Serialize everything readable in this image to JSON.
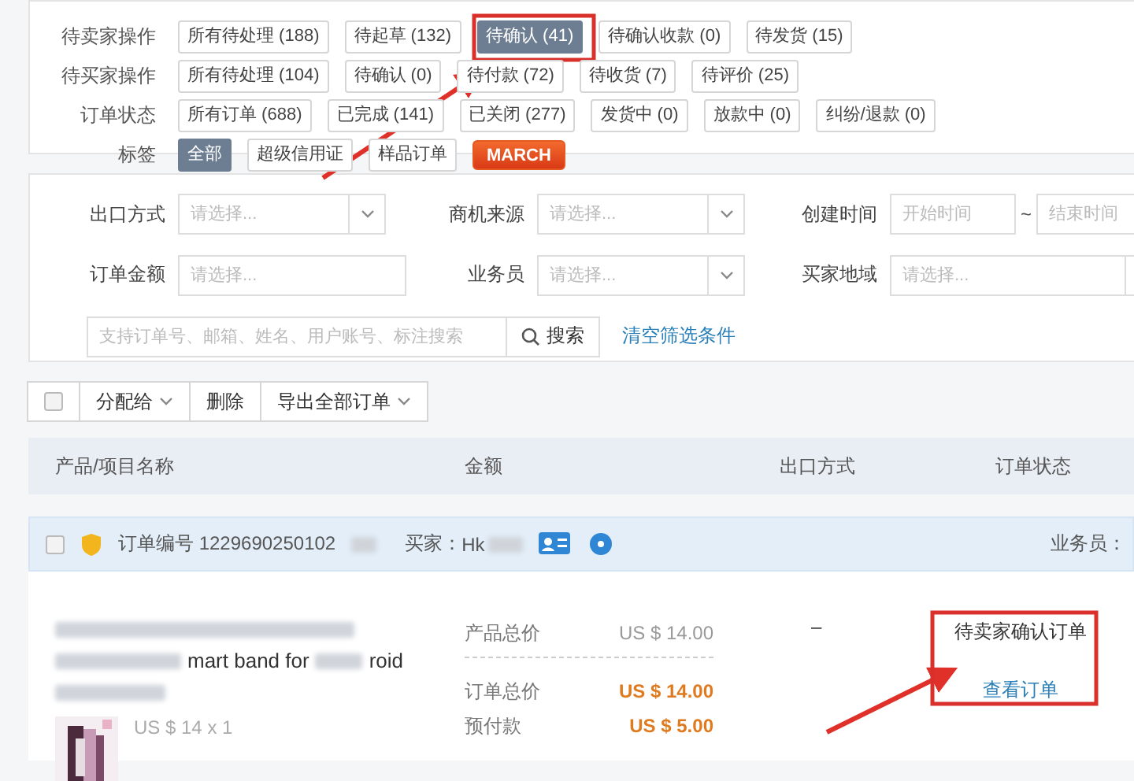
{
  "filters": {
    "groups": [
      {
        "label": "待卖家操作",
        "chips": [
          {
            "label": "所有待处理 (188)",
            "kind": "chip",
            "selected": false
          },
          {
            "label": "待起草 (132)",
            "kind": "chip",
            "selected": false
          },
          {
            "label": "待确认 (41)",
            "kind": "chip",
            "selected": true
          },
          {
            "label": "待确认收款 (0)",
            "kind": "chip",
            "selected": false
          },
          {
            "label": "待发货 (15)",
            "kind": "chip",
            "selected": false
          }
        ]
      },
      {
        "label": "待买家操作",
        "chips": [
          {
            "label": "所有待处理 (104)",
            "kind": "chip",
            "selected": false
          },
          {
            "label": "待确认 (0)",
            "kind": "chip",
            "selected": false
          },
          {
            "label": "待付款 (72)",
            "kind": "chip",
            "selected": false
          },
          {
            "label": "待收货 (7)",
            "kind": "chip",
            "selected": false
          },
          {
            "label": "待评价 (25)",
            "kind": "chip",
            "selected": false
          }
        ]
      },
      {
        "label": "订单状态",
        "chips": [
          {
            "label": "所有订单 (688)",
            "kind": "chip",
            "selected": false
          },
          {
            "label": "已完成 (141)",
            "kind": "chip",
            "selected": false
          },
          {
            "label": "已关闭 (277)",
            "kind": "chip",
            "selected": false
          },
          {
            "label": "发货中 (0)",
            "kind": "chip",
            "selected": false
          },
          {
            "label": "放款中 (0)",
            "kind": "chip",
            "selected": false
          },
          {
            "label": "纠纷/退款 (0)",
            "kind": "chip",
            "selected": false
          }
        ]
      },
      {
        "label": "标签",
        "chips": [
          {
            "label": "全部",
            "kind": "chip",
            "selected": true
          },
          {
            "label": "超级信用证",
            "kind": "chip",
            "selected": false
          },
          {
            "label": "样品订单",
            "kind": "chip",
            "selected": false
          },
          {
            "label": "MARCH",
            "kind": "badge",
            "selected": false
          }
        ]
      }
    ]
  },
  "form": {
    "fields": [
      {
        "label": "出口方式",
        "kind": "select",
        "placeholder": "请选择..."
      },
      {
        "label": "商机来源",
        "kind": "select",
        "placeholder": "请选择..."
      },
      {
        "label": "创建时间",
        "kind": "range",
        "placeholder": "开始时间",
        "separator": "~",
        "placeholder_end": "结束时间"
      },
      {
        "label": "订单金额",
        "kind": "input",
        "placeholder": "请选择..."
      },
      {
        "label": "业务员",
        "kind": "select",
        "placeholder": "请选择..."
      },
      {
        "label": "买家地域",
        "kind": "select",
        "placeholder": "请选择..."
      }
    ],
    "search": {
      "placeholder": "支持订单号、邮箱、姓名、用户账号、标注搜索",
      "button": "搜索"
    },
    "clear_link": "清空筛选条件"
  },
  "toolbar": {
    "checked": false,
    "buttons": [
      {
        "label": "分配给",
        "dropdown": true
      },
      {
        "label": "删除",
        "dropdown": false
      },
      {
        "label": "导出全部订单",
        "dropdown": true
      }
    ]
  },
  "table": {
    "columns": [
      "产品/项目名称",
      "金额",
      "出口方式",
      "订单状态"
    ]
  },
  "order": {
    "checked": false,
    "number": "订单编号 1229690250102",
    "buyer_label": "买家：",
    "buyer": "Hk",
    "agent_label": "业务员：",
    "title_parts": [
      "mart band for",
      "roid"
    ],
    "unit_price": "US $ 14 x 1",
    "amounts": [
      {
        "label": "产品总价",
        "value": "US $ 14.00",
        "emphasis": false
      },
      {
        "label": "订单总价",
        "value": "US $ 14.00",
        "emphasis": true
      },
      {
        "label": "预付款",
        "value": "US $ 5.00",
        "emphasis": true
      }
    ],
    "export": "–",
    "status": "待卖家确认订单",
    "action": "查看订单"
  }
}
